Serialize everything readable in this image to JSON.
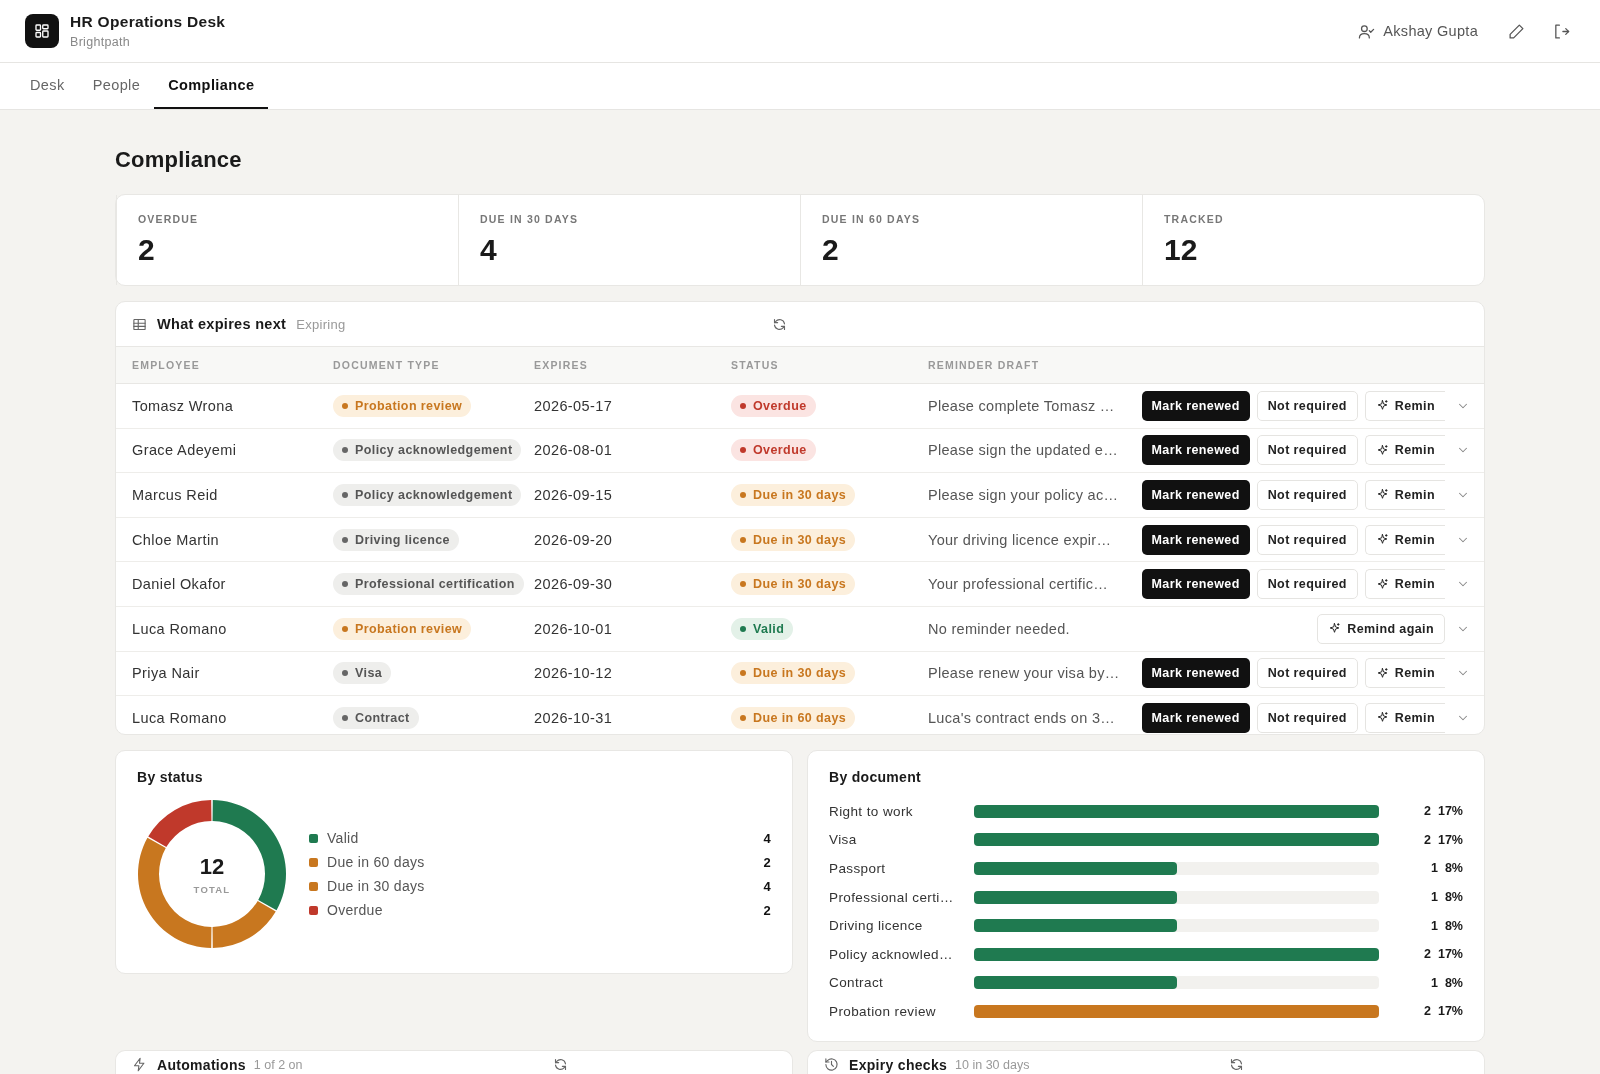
{
  "app": {
    "title": "HR Operations Desk",
    "subtitle": "Brightpath"
  },
  "user": {
    "name": "Akshay Gupta"
  },
  "tabs": [
    {
      "label": "Desk",
      "selected": false
    },
    {
      "label": "People",
      "selected": false
    },
    {
      "label": "Compliance",
      "selected": true
    }
  ],
  "page_title": "Compliance",
  "stats": [
    {
      "label": "OVERDUE",
      "value": "2"
    },
    {
      "label": "DUE IN 30 DAYS",
      "value": "4"
    },
    {
      "label": "DUE IN 60 DAYS",
      "value": "2"
    },
    {
      "label": "TRACKED",
      "value": "12"
    }
  ],
  "expiry_table": {
    "title": "What expires next",
    "subtitle": "Expiring",
    "columns": [
      "EMPLOYEE",
      "DOCUMENT TYPE",
      "EXPIRES",
      "STATUS",
      "REMINDER DRAFT"
    ],
    "rows": [
      {
        "employee": "Tomasz Wrona",
        "document": {
          "label": "Probation review",
          "kind": "probation"
        },
        "expires": "2026-05-17",
        "status": {
          "label": "Overdue",
          "kind": "overdue"
        },
        "reminder": "Please complete Tomasz …",
        "actions": [
          {
            "label": "Mark renewed",
            "kind": "primary"
          },
          {
            "label": "Not required",
            "kind": "secondary"
          },
          {
            "label": "Remin",
            "kind": "remind"
          }
        ]
      },
      {
        "employee": "Grace Adeyemi",
        "document": {
          "label": "Policy acknowledgement",
          "kind": "neutral"
        },
        "expires": "2026-08-01",
        "status": {
          "label": "Overdue",
          "kind": "overdue"
        },
        "reminder": "Please sign the updated e…",
        "actions": [
          {
            "label": "Mark renewed",
            "kind": "primary"
          },
          {
            "label": "Not required",
            "kind": "secondary"
          },
          {
            "label": "Remin",
            "kind": "remind"
          }
        ]
      },
      {
        "employee": "Marcus Reid",
        "document": {
          "label": "Policy acknowledgement",
          "kind": "neutral"
        },
        "expires": "2026-09-15",
        "status": {
          "label": "Due in 30 days",
          "kind": "due"
        },
        "reminder": "Please sign your policy ac…",
        "actions": [
          {
            "label": "Mark renewed",
            "kind": "primary"
          },
          {
            "label": "Not required",
            "kind": "secondary"
          },
          {
            "label": "Remin",
            "kind": "remind"
          }
        ]
      },
      {
        "employee": "Chloe Martin",
        "document": {
          "label": "Driving licence",
          "kind": "neutral"
        },
        "expires": "2026-09-20",
        "status": {
          "label": "Due in 30 days",
          "kind": "due"
        },
        "reminder": "Your driving licence expir…",
        "actions": [
          {
            "label": "Mark renewed",
            "kind": "primary"
          },
          {
            "label": "Not required",
            "kind": "secondary"
          },
          {
            "label": "Remin",
            "kind": "remind"
          }
        ]
      },
      {
        "employee": "Daniel Okafor",
        "document": {
          "label": "Professional certification",
          "kind": "neutral"
        },
        "expires": "2026-09-30",
        "status": {
          "label": "Due in 30 days",
          "kind": "due"
        },
        "reminder": "Your professional certific…",
        "actions": [
          {
            "label": "Mark renewed",
            "kind": "primary"
          },
          {
            "label": "Not required",
            "kind": "secondary"
          },
          {
            "label": "Remin",
            "kind": "remind"
          }
        ]
      },
      {
        "employee": "Luca Romano",
        "document": {
          "label": "Probation review",
          "kind": "probation"
        },
        "expires": "2026-10-01",
        "status": {
          "label": "Valid",
          "kind": "valid"
        },
        "reminder": "No reminder needed.",
        "actions": [
          {
            "label": "Remind again",
            "kind": "remind"
          }
        ]
      },
      {
        "employee": "Priya Nair",
        "document": {
          "label": "Visa",
          "kind": "neutral"
        },
        "expires": "2026-10-12",
        "status": {
          "label": "Due in 30 days",
          "kind": "due"
        },
        "reminder": "Please renew your visa by…",
        "actions": [
          {
            "label": "Mark renewed",
            "kind": "primary"
          },
          {
            "label": "Not required",
            "kind": "secondary"
          },
          {
            "label": "Remin",
            "kind": "remind"
          }
        ]
      },
      {
        "employee": "Luca Romano",
        "document": {
          "label": "Contract",
          "kind": "neutral"
        },
        "expires": "2026-10-31",
        "status": {
          "label": "Due in 60 days",
          "kind": "due"
        },
        "reminder": "Luca's contract ends on 3…",
        "actions": [
          {
            "label": "Mark renewed",
            "kind": "primary"
          },
          {
            "label": "Not required",
            "kind": "secondary"
          },
          {
            "label": "Remin",
            "kind": "remind"
          }
        ]
      }
    ]
  },
  "by_status": {
    "title": "By status",
    "total": "12",
    "total_label": "TOTAL",
    "chart_data": {
      "type": "donut",
      "categories": [
        "Valid",
        "Due in 60 days",
        "Due in 30 days",
        "Overdue"
      ],
      "series": [
        {
          "values": [
            33.3,
            16.7,
            33.3,
            16.7
          ]
        }
      ]
    },
    "legend": [
      {
        "count": "4",
        "color": "#1f7a50"
      },
      {
        "count": "2",
        "color": "#c8771f"
      },
      {
        "count": "4",
        "color": "#c8771f"
      },
      {
        "count": "2",
        "color": "#c0392b"
      }
    ]
  },
  "by_document": {
    "title": "By document",
    "items": [
      {
        "label": "Right to work",
        "level": 1,
        "count": "2",
        "percent": "17%",
        "color": "#1f7a50"
      },
      {
        "label": "Visa",
        "level": 1,
        "count": "2",
        "percent": "17%",
        "color": "#1f7a50"
      },
      {
        "label": "Passport",
        "level": 0.5,
        "count": "1",
        "percent": "8%",
        "color": "#1f7a50"
      },
      {
        "label": "Professional certi…",
        "level": 0.5,
        "count": "1",
        "percent": "8%",
        "color": "#1f7a50"
      },
      {
        "label": "Driving licence",
        "level": 0.5,
        "count": "1",
        "percent": "8%",
        "color": "#1f7a50"
      },
      {
        "label": "Policy acknowled…",
        "level": 1,
        "count": "2",
        "percent": "17%",
        "color": "#1f7a50"
      },
      {
        "label": "Contract",
        "level": 0.5,
        "count": "1",
        "percent": "8%",
        "color": "#1f7a50"
      },
      {
        "label": "Probation review",
        "level": 1,
        "count": "2",
        "percent": "17%",
        "color": "#c8771f"
      }
    ]
  },
  "panels": [
    {
      "title": "Automations",
      "note": "1 of 2 on"
    },
    {
      "title": "Expiry checks",
      "note": "10 in 30 days"
    }
  ]
}
